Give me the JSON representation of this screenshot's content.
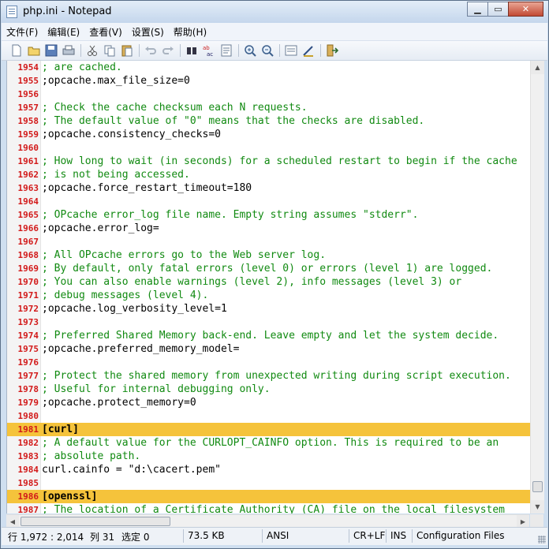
{
  "window": {
    "title": "php.ini - Notepad"
  },
  "menu": [
    {
      "label": "文件(F)"
    },
    {
      "label": "编辑(E)"
    },
    {
      "label": "查看(V)"
    },
    {
      "label": "设置(S)"
    },
    {
      "label": "帮助(H)"
    }
  ],
  "toolbar_icons": [
    "new-file-icon",
    "open-file-icon",
    "save-icon",
    "print-icon",
    "cut-icon",
    "copy-icon",
    "paste-icon",
    "undo-icon",
    "redo-icon",
    "find-icon",
    "replace-icon",
    "goto-icon",
    "zoom-in-icon",
    "zoom-out-icon",
    "word-wrap-icon",
    "settings-icon",
    "exit-icon"
  ],
  "editor": {
    "lines": [
      {
        "num": "1954",
        "text": "; are cached.",
        "kind": "comment"
      },
      {
        "num": "1955",
        "text": ";opcache.max_file_size=0",
        "kind": "code"
      },
      {
        "num": "1956",
        "text": "",
        "kind": "code"
      },
      {
        "num": "1957",
        "text": "; Check the cache checksum each N requests.",
        "kind": "comment"
      },
      {
        "num": "1958",
        "text": "; The default value of \"0\" means that the checks are disabled.",
        "kind": "comment"
      },
      {
        "num": "1959",
        "text": ";opcache.consistency_checks=0",
        "kind": "code"
      },
      {
        "num": "1960",
        "text": "",
        "kind": "code"
      },
      {
        "num": "1961",
        "text": "; How long to wait (in seconds) for a scheduled restart to begin if the cache",
        "kind": "comment"
      },
      {
        "num": "1962",
        "text": "; is not being accessed.",
        "kind": "comment"
      },
      {
        "num": "1963",
        "text": ";opcache.force_restart_timeout=180",
        "kind": "code"
      },
      {
        "num": "1964",
        "text": "",
        "kind": "code"
      },
      {
        "num": "1965",
        "text": "; OPcache error_log file name. Empty string assumes \"stderr\".",
        "kind": "comment"
      },
      {
        "num": "1966",
        "text": ";opcache.error_log=",
        "kind": "code"
      },
      {
        "num": "1967",
        "text": "",
        "kind": "code"
      },
      {
        "num": "1968",
        "text": "; All OPcache errors go to the Web server log.",
        "kind": "comment"
      },
      {
        "num": "1969",
        "text": "; By default, only fatal errors (level 0) or errors (level 1) are logged.",
        "kind": "comment"
      },
      {
        "num": "1970",
        "text": "; You can also enable warnings (level 2), info messages (level 3) or",
        "kind": "comment"
      },
      {
        "num": "1971",
        "text": "; debug messages (level 4).",
        "kind": "comment"
      },
      {
        "num": "1972",
        "text": ";opcache.log_verbosity_level=1",
        "kind": "code"
      },
      {
        "num": "1973",
        "text": "",
        "kind": "code"
      },
      {
        "num": "1974",
        "text": "; Preferred Shared Memory back-end. Leave empty and let the system decide.",
        "kind": "comment"
      },
      {
        "num": "1975",
        "text": ";opcache.preferred_memory_model=",
        "kind": "code"
      },
      {
        "num": "1976",
        "text": "",
        "kind": "code"
      },
      {
        "num": "1977",
        "text": "; Protect the shared memory from unexpected writing during script execution.",
        "kind": "comment"
      },
      {
        "num": "1978",
        "text": "; Useful for internal debugging only.",
        "kind": "comment"
      },
      {
        "num": "1979",
        "text": ";opcache.protect_memory=0",
        "kind": "code"
      },
      {
        "num": "1980",
        "text": "",
        "kind": "code"
      },
      {
        "num": "1981",
        "text": "[curl]",
        "kind": "section"
      },
      {
        "num": "1982",
        "text": "; A default value for the CURLOPT_CAINFO option. This is required to be an",
        "kind": "comment"
      },
      {
        "num": "1983",
        "text": "; absolute path.",
        "kind": "comment"
      },
      {
        "num": "1984",
        "text": "curl.cainfo = \"d:\\cacert.pem\"",
        "kind": "code"
      },
      {
        "num": "1985",
        "text": "",
        "kind": "code"
      },
      {
        "num": "1986",
        "text": "[openssl]",
        "kind": "section"
      },
      {
        "num": "1987",
        "text": "; The location of a Certificate Authority (CA) file on the local filesystem",
        "kind": "comment"
      }
    ]
  },
  "status": {
    "position": "行 1,972 : 2,014",
    "column": "列 31",
    "selection": "选定 0",
    "size": "73.5 KB",
    "encoding": "ANSI",
    "line_ending": "CR+LF",
    "mode": "INS",
    "file_type": "Configuration Files"
  }
}
